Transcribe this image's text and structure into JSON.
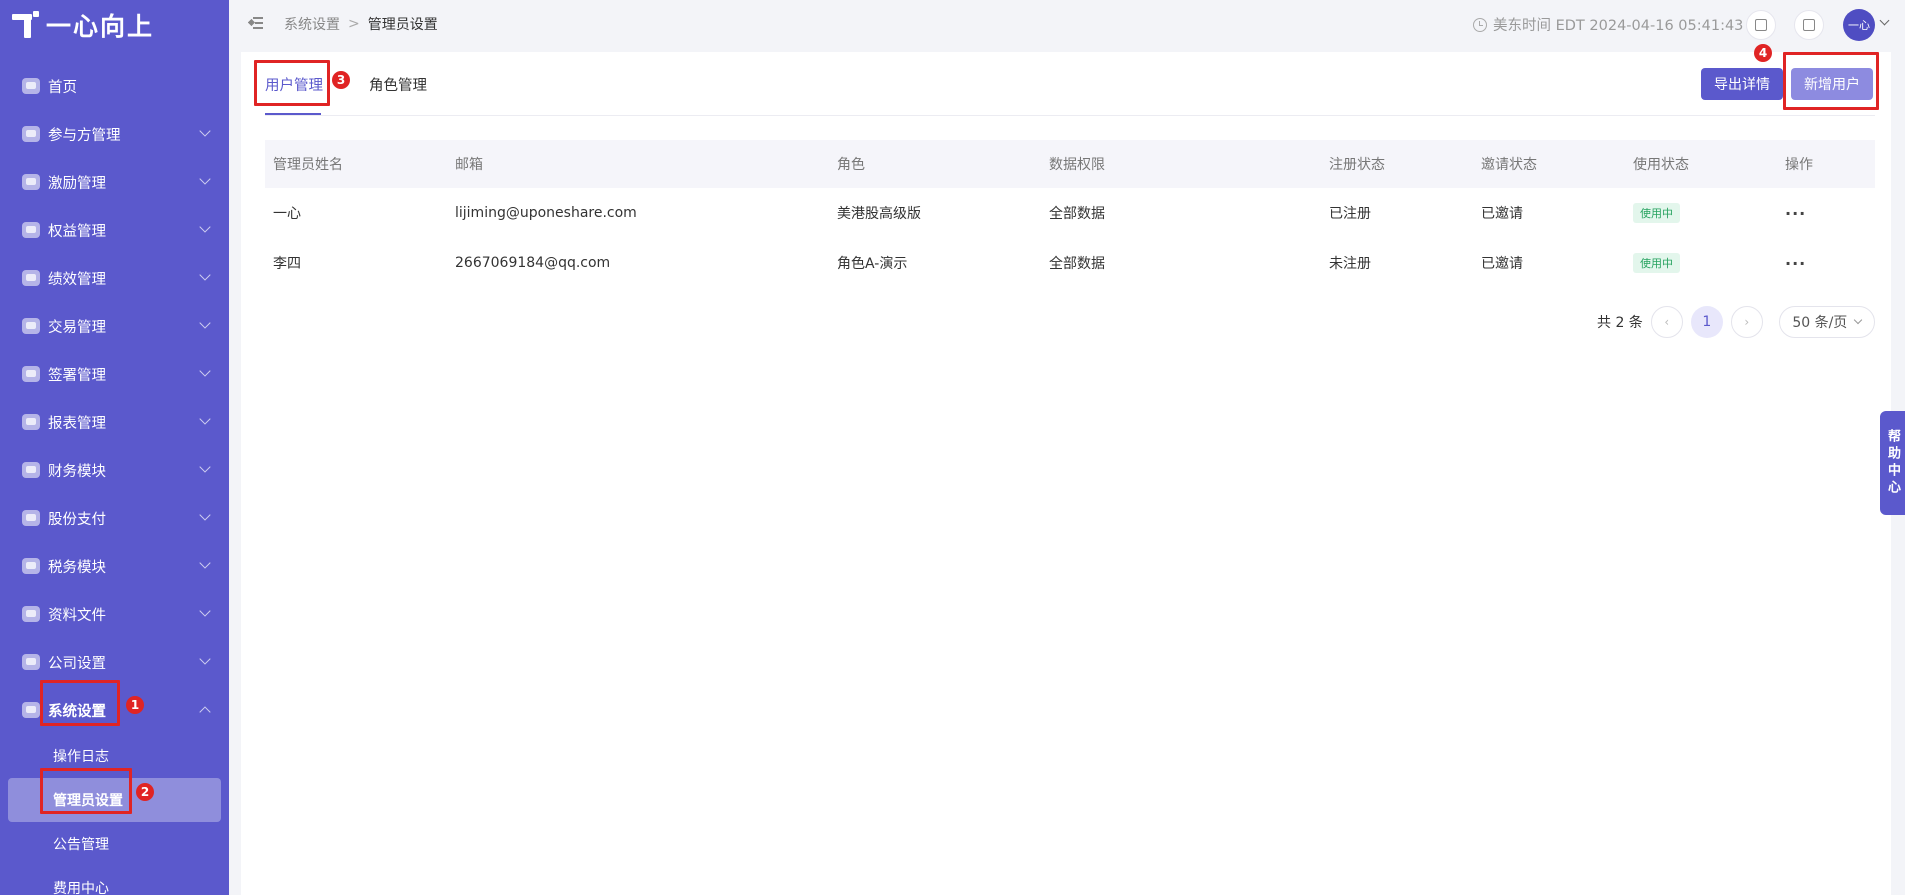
{
  "brand": {
    "name": "一心向上"
  },
  "sidebar": {
    "items": [
      {
        "label": "首页",
        "has_chevron": false
      },
      {
        "label": "参与方管理",
        "has_chevron": true
      },
      {
        "label": "激励管理",
        "has_chevron": true
      },
      {
        "label": "权益管理",
        "has_chevron": true
      },
      {
        "label": "绩效管理",
        "has_chevron": true
      },
      {
        "label": "交易管理",
        "has_chevron": true
      },
      {
        "label": "签署管理",
        "has_chevron": true
      },
      {
        "label": "报表管理",
        "has_chevron": true
      },
      {
        "label": "财务模块",
        "has_chevron": true
      },
      {
        "label": "股份支付",
        "has_chevron": true
      },
      {
        "label": "税务模块",
        "has_chevron": true
      },
      {
        "label": "资料文件",
        "has_chevron": true
      },
      {
        "label": "公司设置",
        "has_chevron": true
      },
      {
        "label": "系统设置",
        "has_chevron": true,
        "expanded": true
      }
    ],
    "sub_items": [
      {
        "label": "操作日志"
      },
      {
        "label": "管理员设置",
        "selected": true
      },
      {
        "label": "公告管理"
      },
      {
        "label": "费用中心"
      }
    ]
  },
  "topbar": {
    "breadcrumb": [
      "系统设置",
      "管理员设置"
    ],
    "separator": ">",
    "time": "美东时间 EDT 2024-04-16 05:41:43",
    "avatar_text": "一心"
  },
  "tabs": [
    {
      "label": "用户管理",
      "active": true
    },
    {
      "label": "角色管理",
      "active": false
    }
  ],
  "buttons": {
    "export": "导出详情",
    "add_user": "新增用户"
  },
  "table": {
    "headers": [
      "管理员姓名",
      "邮箱",
      "角色",
      "数据权限",
      "注册状态",
      "邀请状态",
      "使用状态",
      "操作"
    ],
    "rows": [
      {
        "name": "一心",
        "email": "lijiming@uponeshare.com",
        "role": "美港股高级版",
        "data_scope": "全部数据",
        "reg_status": "已注册",
        "invite_status": "已邀请",
        "use_status": "使用中",
        "action": "···"
      },
      {
        "name": "李四",
        "email": "2667069184@qq.com",
        "role": "角色A-演示",
        "data_scope": "全部数据",
        "reg_status": "未注册",
        "invite_status": "已邀请",
        "use_status": "使用中",
        "action": "···"
      }
    ]
  },
  "pagination": {
    "total_text": "共 2 条",
    "current_page": "1",
    "page_size": "50 条/页"
  },
  "help": {
    "label": "帮助中心"
  },
  "annotations": [
    "1",
    "2",
    "3",
    "4"
  ],
  "colors": {
    "sidebar": "#5b59cc",
    "primary": "#5b59cc",
    "highlight": "#e02424",
    "status_green": "#27a360"
  }
}
